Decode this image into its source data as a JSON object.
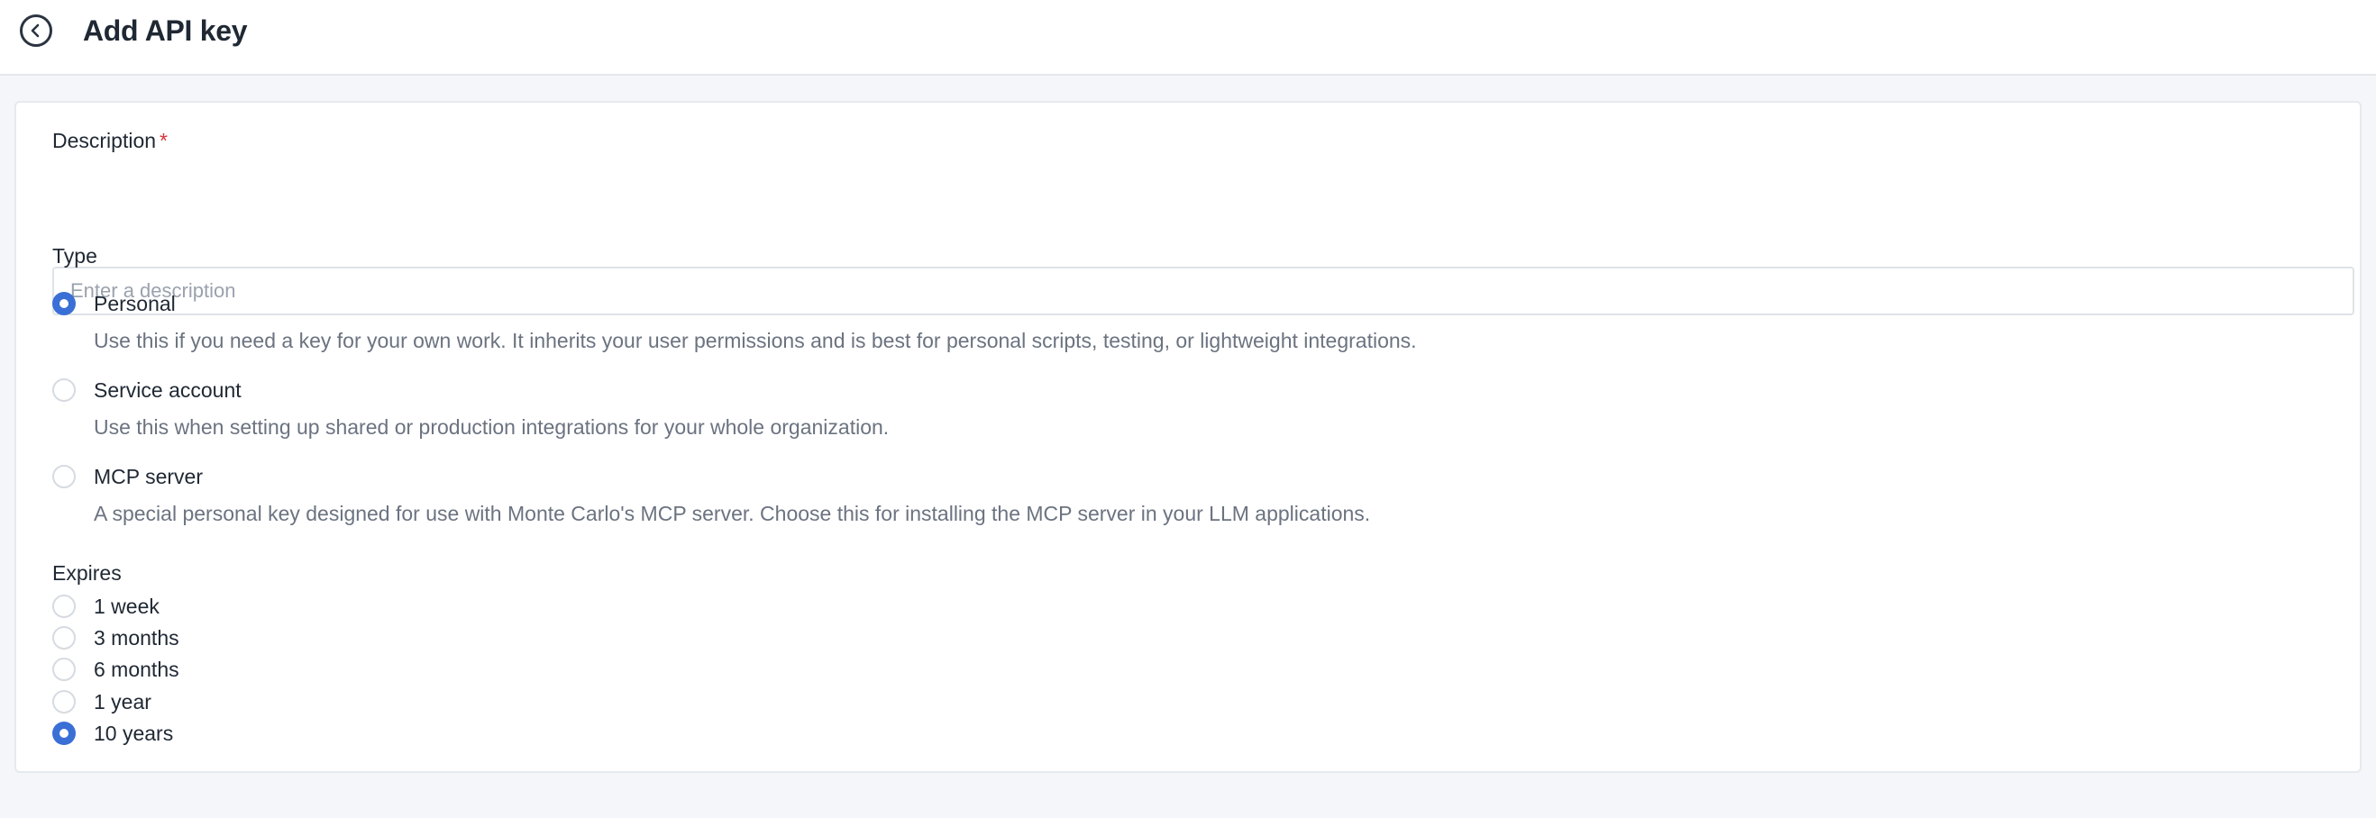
{
  "header": {
    "title": "Add API key"
  },
  "form": {
    "description": {
      "label": "Description",
      "required_mark": "*",
      "placeholder": "Enter a description",
      "value": ""
    },
    "type": {
      "label": "Type",
      "selected": "Personal",
      "options": [
        {
          "label": "Personal",
          "help": "Use this if you need a key for your own work. It inherits your user permissions and is best for personal scripts, testing, or lightweight integrations.",
          "checked": true
        },
        {
          "label": "Service account",
          "help": "Use this when setting up shared or production integrations for your whole organization.",
          "checked": false
        },
        {
          "label": "MCP server",
          "help": "A special personal key designed for use with Monte Carlo's MCP server. Choose this for installing the MCP server in your LLM applications.",
          "checked": false
        }
      ]
    },
    "expires": {
      "label": "Expires",
      "selected": "10 years",
      "options": [
        {
          "label": "1 week",
          "checked": false
        },
        {
          "label": "3 months",
          "checked": false
        },
        {
          "label": "6 months",
          "checked": false
        },
        {
          "label": "1 year",
          "checked": false
        },
        {
          "label": "10 years",
          "checked": true
        }
      ]
    }
  },
  "colors": {
    "accent": "#3a6fd6",
    "required": "#d5343a",
    "help_text": "#6b7380",
    "background": "#f5f6f9"
  }
}
